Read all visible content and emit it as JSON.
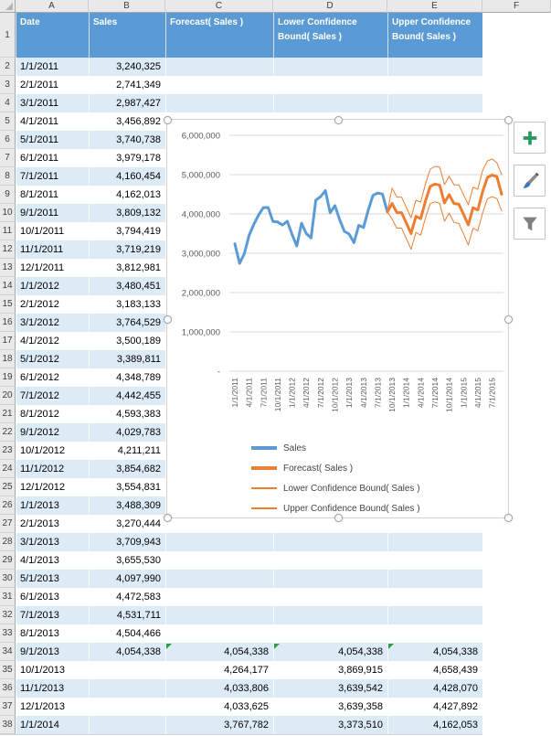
{
  "app": {
    "title": "Excel worksheet with sales forecast table and forecast chart"
  },
  "grid": {
    "column_letters": [
      "A",
      "B",
      "C",
      "D",
      "E",
      "F"
    ],
    "row_count": 38
  },
  "table": {
    "headers": [
      "Date",
      "Sales",
      "Forecast( Sales )",
      "Lower Confidence Bound( Sales )",
      "Upper Confidence Bound( Sales )"
    ],
    "rows": [
      [
        "1/1/2011",
        "3,240,325",
        "",
        "",
        ""
      ],
      [
        "2/1/2011",
        "2,741,349",
        "",
        "",
        ""
      ],
      [
        "3/1/2011",
        "2,987,427",
        "",
        "",
        ""
      ],
      [
        "4/1/2011",
        "3,456,892",
        "",
        "",
        ""
      ],
      [
        "5/1/2011",
        "3,740,738",
        "",
        "",
        ""
      ],
      [
        "6/1/2011",
        "3,979,178",
        "",
        "",
        ""
      ],
      [
        "7/1/2011",
        "4,160,454",
        "",
        "",
        ""
      ],
      [
        "8/1/2011",
        "4,162,013",
        "",
        "",
        ""
      ],
      [
        "9/1/2011",
        "3,809,132",
        "",
        "",
        ""
      ],
      [
        "10/1/2011",
        "3,794,419",
        "",
        "",
        ""
      ],
      [
        "11/1/2011",
        "3,719,219",
        "",
        "",
        ""
      ],
      [
        "12/1/2011",
        "3,812,981",
        "",
        "",
        ""
      ],
      [
        "1/1/2012",
        "3,480,451",
        "",
        "",
        ""
      ],
      [
        "2/1/2012",
        "3,183,133",
        "",
        "",
        ""
      ],
      [
        "3/1/2012",
        "3,764,529",
        "",
        "",
        ""
      ],
      [
        "4/1/2012",
        "3,500,189",
        "",
        "",
        ""
      ],
      [
        "5/1/2012",
        "3,389,811",
        "",
        "",
        ""
      ],
      [
        "6/1/2012",
        "4,348,789",
        "",
        "",
        ""
      ],
      [
        "7/1/2012",
        "4,442,455",
        "",
        "",
        ""
      ],
      [
        "8/1/2012",
        "4,593,383",
        "",
        "",
        ""
      ],
      [
        "9/1/2012",
        "4,029,783",
        "",
        "",
        ""
      ],
      [
        "10/1/2012",
        "4,211,211",
        "",
        "",
        ""
      ],
      [
        "11/1/2012",
        "3,854,682",
        "",
        "",
        ""
      ],
      [
        "12/1/2012",
        "3,554,831",
        "",
        "",
        ""
      ],
      [
        "1/1/2013",
        "3,488,309",
        "",
        "",
        ""
      ],
      [
        "2/1/2013",
        "3,270,444",
        "",
        "",
        ""
      ],
      [
        "3/1/2013",
        "3,709,943",
        "",
        "",
        ""
      ],
      [
        "4/1/2013",
        "3,655,530",
        "",
        "",
        ""
      ],
      [
        "5/1/2013",
        "4,097,990",
        "",
        "",
        ""
      ],
      [
        "6/1/2013",
        "4,472,583",
        "",
        "",
        ""
      ],
      [
        "7/1/2013",
        "4,531,711",
        "",
        "",
        ""
      ],
      [
        "8/1/2013",
        "4,504,466",
        "",
        "",
        ""
      ],
      [
        "9/1/2013",
        "4,054,338",
        "4,054,338",
        "4,054,338",
        "4,054,338"
      ],
      [
        "10/1/2013",
        "",
        "4,264,177",
        "3,869,915",
        "4,658,439"
      ],
      [
        "11/1/2013",
        "",
        "4,033,806",
        "3,639,542",
        "4,428,070"
      ],
      [
        "12/1/2013",
        "",
        "4,033,625",
        "3,639,358",
        "4,427,892"
      ],
      [
        "1/1/2014",
        "",
        "3,767,782",
        "3,373,510",
        "4,162,053"
      ]
    ],
    "error_indicator_cells": [
      {
        "row": 34,
        "col": 2
      },
      {
        "row": 34,
        "col": 3
      },
      {
        "row": 34,
        "col": 4
      }
    ]
  },
  "chart_data": {
    "type": "line",
    "title": "",
    "xlabel": "",
    "ylabel": "",
    "grid": true,
    "ylim": [
      0,
      6000000
    ],
    "legend_position": "bottom-left-stacked",
    "y_ticks": [
      {
        "label": "6,000,000",
        "value": 6000000
      },
      {
        "label": "5,000,000",
        "value": 5000000
      },
      {
        "label": "4,000,000",
        "value": 4000000
      },
      {
        "label": "3,000,000",
        "value": 3000000
      },
      {
        "label": "2,000,000",
        "value": 2000000
      },
      {
        "label": "1,000,000",
        "value": 1000000
      },
      {
        "label": "-",
        "value": 0
      }
    ],
    "x_tick_labels": [
      "1/1/2011",
      "4/1/2011",
      "7/1/2011",
      "10/1/2011",
      "1/1/2012",
      "4/1/2012",
      "7/1/2012",
      "10/1/2012",
      "1/1/2013",
      "4/1/2013",
      "7/1/2013",
      "10/1/2013",
      "1/1/2014",
      "4/1/2014",
      "7/1/2014",
      "10/1/2014",
      "1/1/2015",
      "4/1/2015",
      "7/1/2015"
    ],
    "x_tick_every": 3,
    "months_total": 57,
    "series": [
      {
        "name": "Sales",
        "color": "#5B9BD5",
        "width": 3,
        "start_index": 0,
        "values": [
          3240325,
          2741349,
          2987427,
          3456892,
          3740738,
          3979178,
          4160454,
          4162013,
          3809132,
          3794419,
          3719219,
          3812981,
          3480451,
          3183133,
          3764529,
          3500189,
          3389811,
          4348789,
          4442455,
          4593383,
          4029783,
          4211211,
          3854682,
          3554831,
          3488309,
          3270444,
          3709943,
          3655530,
          4097990,
          4472583,
          4531711,
          4504466,
          4054338
        ]
      },
      {
        "name": "Forecast( Sales )",
        "color": "#ED7D31",
        "width": 3,
        "start_index": 32,
        "values": [
          4054338,
          4264177,
          4033806,
          4033625,
          3767782,
          3500000,
          3940000,
          3880000,
          4330000,
          4700000,
          4760000,
          4730000,
          4280000,
          4490000,
          4260000,
          4250000,
          3990000,
          3720000,
          4160000,
          4100000,
          4560000,
          4930000,
          4990000,
          4950000,
          4500000
        ]
      },
      {
        "name": "Lower Confidence Bound( Sales )",
        "color": "#ED7D31",
        "width": 1,
        "start_index": 32,
        "values": [
          4054338,
          3869915,
          3639542,
          3639358,
          3373510,
          3097000,
          3530000,
          3460000,
          3900000,
          4260000,
          4310000,
          4270000,
          3815000,
          4020000,
          3780000,
          3760000,
          3490000,
          3210000,
          3640000,
          3570000,
          4020000,
          4385000,
          4440000,
          4390000,
          4080000
        ]
      },
      {
        "name": "Upper Confidence Bound( Sales )",
        "color": "#ED7D31",
        "width": 1,
        "start_index": 32,
        "values": [
          4054338,
          4658439,
          4428070,
          4427892,
          4162053,
          3903000,
          4350000,
          4300000,
          4760000,
          5140000,
          5210000,
          5190000,
          4745000,
          4960000,
          4740000,
          4740000,
          4490000,
          4230000,
          4680000,
          4630000,
          5100000,
          5350000,
          5400000,
          5300000,
          5000000
        ]
      }
    ]
  },
  "chart_buttons": [
    {
      "id": "chart-elements",
      "label": "Chart Elements"
    },
    {
      "id": "chart-styles",
      "label": "Chart Styles"
    },
    {
      "id": "chart-filters",
      "label": "Chart Filters"
    }
  ],
  "colors": {
    "header_blue": "#5B9BD5",
    "band_blue": "#DDEBF7",
    "sales_line": "#5B9BD5",
    "forecast_line": "#ED7D31",
    "gridline": "#D9D9D9",
    "axis_text": "#595959",
    "plus_green": "#27975B",
    "icon_gray": "#808080",
    "error_green": "#2E9B47"
  }
}
